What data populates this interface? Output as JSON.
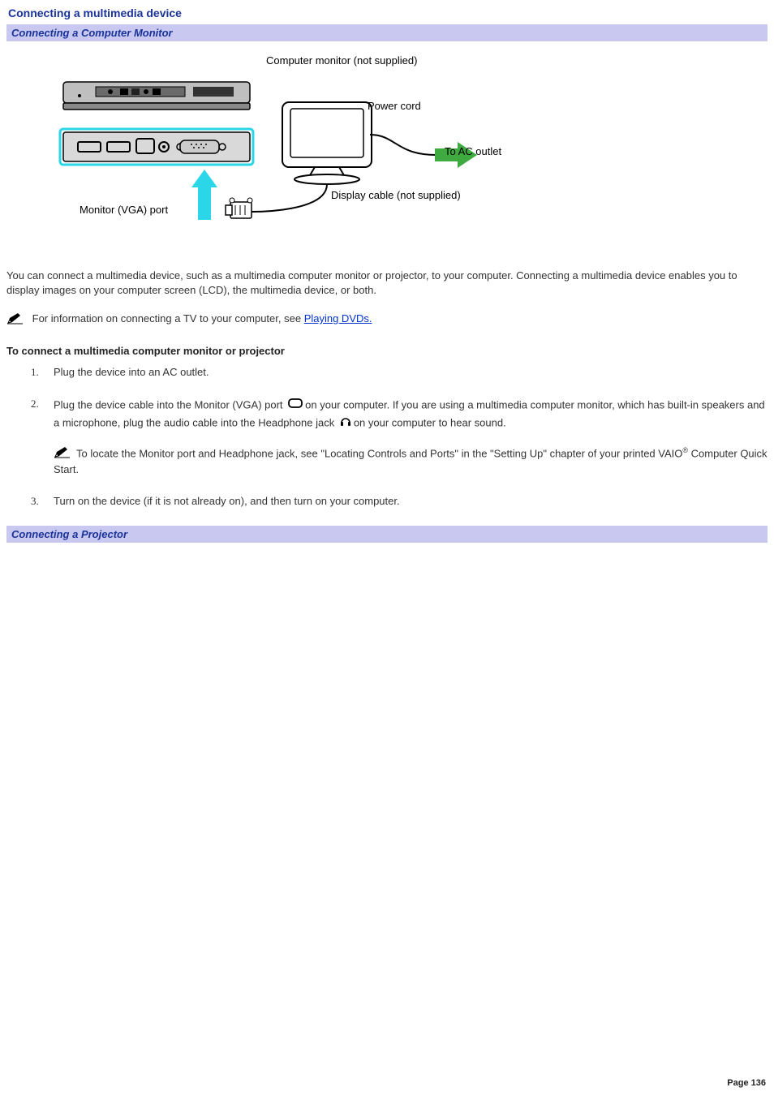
{
  "title": "Connecting a multimedia device",
  "section1": "Connecting a Computer Monitor",
  "section2": "Connecting a Projector",
  "diagram": {
    "monitor_label": "Computer monitor (not supplied)",
    "power_cord": "Power cord",
    "ac_outlet": "To AC outlet",
    "display_cable": "Display cable (not supplied)",
    "vga_port": "Monitor (VGA) port"
  },
  "intro": "You can connect a multimedia device, such as a multimedia computer monitor or projector, to your computer. Connecting a multimedia device enables you to display images on your computer screen (LCD), the multimedia device, or both.",
  "note1_prefix": "For information on connecting a TV to your computer, see ",
  "note1_link": "Playing DVDs.",
  "subheading": "To connect a multimedia computer monitor or projector",
  "step1": "Plug the device into an AC outlet.",
  "step2a": "Plug the device cable into the Monitor (VGA) port ",
  "step2b": "on your computer. If you are using a multimedia computer monitor, which has built-in speakers and a microphone, plug the audio cable into the Headphone jack ",
  "step2c": "on your computer to hear sound.",
  "step2_note_a": "To locate the Monitor port and Headphone jack, see \"Locating Controls and Ports\" in the \"Setting Up\" chapter of your printed VAIO",
  "step2_note_b": " Computer Quick Start.",
  "step3": "Turn on the device (if it is not already on), and then turn on your computer.",
  "footer": "Page 136"
}
